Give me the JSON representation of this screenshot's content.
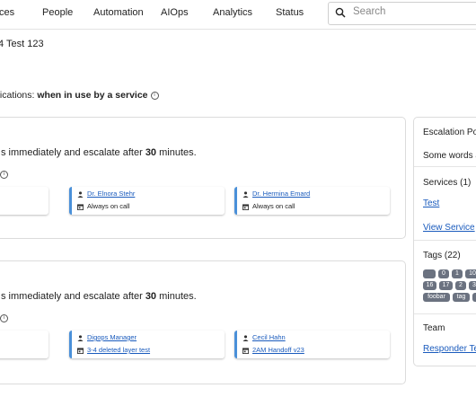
{
  "nav": {
    "items": [
      "ces",
      "People",
      "Automation",
      "AIOps",
      "Analytics",
      "Status"
    ],
    "search_placeholder": "Search"
  },
  "page": {
    "subtitle": "4 Test 123",
    "notifications_prefix": "fications: ",
    "notifications_value": "when in use by a service"
  },
  "rules": [
    {
      "text_prefix": "s immediately and escalate after ",
      "minutes": "30",
      "text_suffix": " minutes.",
      "targets": [
        {
          "name": "Dr. Elnora Stehr",
          "sub": "Always on call"
        },
        {
          "name": "Dr. Hermina Emard",
          "sub": "Always on call"
        }
      ]
    },
    {
      "text_prefix": "s immediately and escalate after ",
      "minutes": "30",
      "text_suffix": " minutes.",
      "targets": [
        {
          "name": "Digops Manager",
          "sub": "3-4 deleted layer test"
        },
        {
          "name": "Cecil Hahn",
          "sub": "2AM Handoff v23"
        }
      ]
    }
  ],
  "sidebar": {
    "title": "Escalation Po",
    "description": "Some words a",
    "services_header": "Services (1)",
    "service_link": "Test",
    "view_services": "View Service",
    "tags_header": "Tags (22)",
    "tags_row1": [
      "",
      "0",
      "1",
      "10"
    ],
    "tags_row2": [
      "16",
      "17",
      "2",
      "3"
    ],
    "tags_row3": [
      "foobar",
      "tag",
      ""
    ],
    "team_header": "Team",
    "team_link": "Responder Te"
  },
  "colors": {
    "accent": "#4a90d9",
    "link": "#1a5bbd",
    "tag_bg": "#6b7280"
  }
}
